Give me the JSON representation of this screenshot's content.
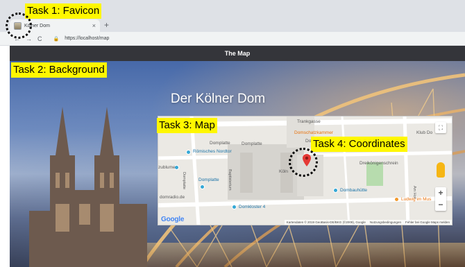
{
  "browser": {
    "tab_title": "Kölner Dom",
    "tab_close": "×",
    "new_tab": "+",
    "url": "https://localhost/map",
    "nav_back": "←",
    "nav_forward": "→",
    "nav_reload": "C",
    "lock_icon": "🔒"
  },
  "page": {
    "header_title": "The Map",
    "title": "Der Kölner Dom"
  },
  "map": {
    "labels": {
      "trankgasse": "Trankgasse",
      "domschatzkammer": "Domschatzkammer",
      "klubdo": "Klub Do",
      "domkloster": "Domkloster",
      "domplatte_top": "Domplatte",
      "roemisches_nordtor": "Römisches Nordtor",
      "dreikoenigen": "Dreikönigenschrein",
      "zbuelme": "zublume",
      "domplatte_left": "Domplatte",
      "domplatte_mid": "Domplatte",
      "koeln": "Köln",
      "domradio": "domradio.de",
      "dombauhuette": "Dombauhütte",
      "domkloster4": "Domkloster 4",
      "ludwig": "Ludwig im Mus",
      "vertical_1": "Domplatte",
      "vertical_2": "Baptisterium",
      "vertical_3": "Am Hof",
      "google": "Google",
      "footer_data": "Kartendaten © 2019 GeoBasis-DE/BKG (©2009), Google",
      "footer_terms": "Nutzungsbedingungen",
      "footer_report": "Fehler bei Google Maps melden"
    },
    "fullscreen_icon": "⛶",
    "zoom_in": "+",
    "zoom_out": "−"
  },
  "annotations": {
    "task1": "Task 1: Favicon",
    "task2": "Task 2: Background",
    "task3": "Task 3: Map",
    "task4": "Task 4: Coordinates"
  },
  "colors": {
    "annotation_bg": "#fff700",
    "header_bg": "#34353a",
    "marker": "#e53935",
    "poi_blue": "#35a8d6",
    "poi_orange": "#f29a2e"
  }
}
